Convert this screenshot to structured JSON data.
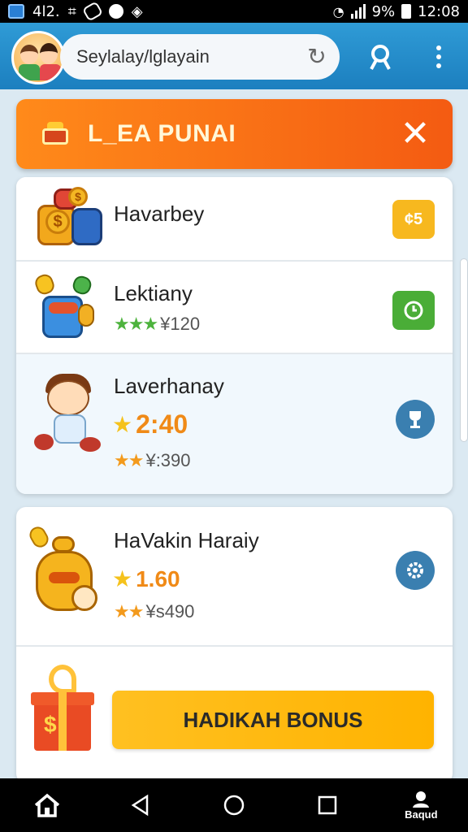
{
  "status_bar": {
    "left_text": "4l2.",
    "battery": "9%",
    "time": "12:08"
  },
  "app_bar": {
    "search_value": "Seylalay/lglayain"
  },
  "banner": {
    "title": "L_EA PUNAI"
  },
  "items": [
    {
      "title": "Havarbey",
      "action_label": "¢5"
    },
    {
      "title": "Lektiany",
      "stars": "★★★",
      "sub": "¥120"
    },
    {
      "title": "Laverhanay",
      "rating": "2:40",
      "stars": "★★",
      "sub": "¥:390"
    }
  ],
  "card2": {
    "title": "HaVakin Haraiy",
    "rating": "1.60",
    "stars": "★★",
    "sub": "¥s490",
    "bonus_label": "HADIKAH BONUS"
  },
  "nav": {
    "profile_label": "Baqud"
  },
  "colors": {
    "accent_orange": "#f45b12",
    "app_bar_blue": "#1c7fbf",
    "bonus_yellow": "#ffb300"
  }
}
